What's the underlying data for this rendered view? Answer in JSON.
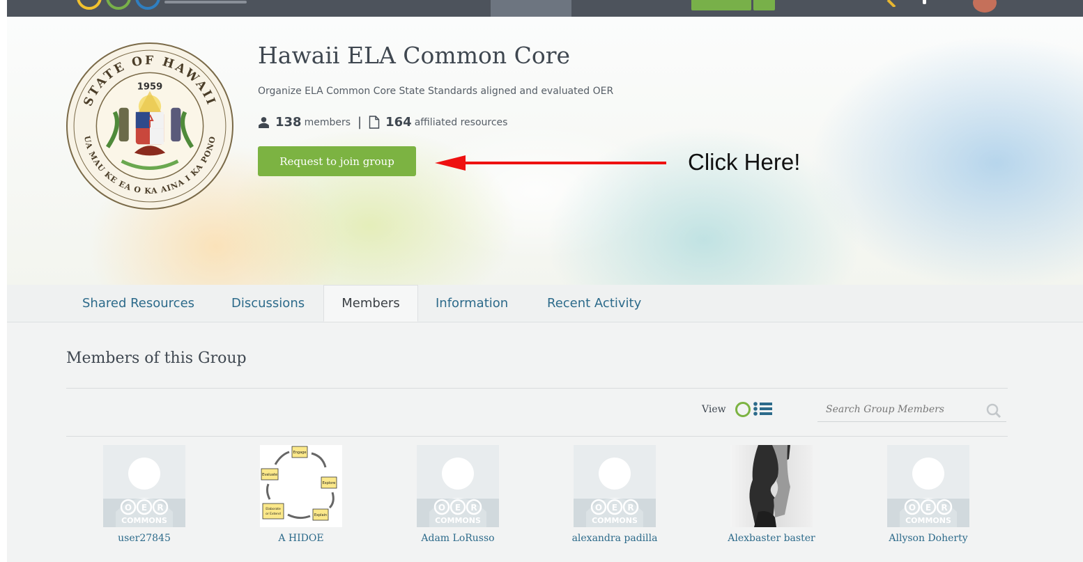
{
  "header": {
    "logo_colors": [
      "#f2c12e",
      "#78b049",
      "#2f7fc1"
    ]
  },
  "group": {
    "title": "Hawaii ELA Common Core",
    "description": "Organize ELA Common Core State Standards aligned and evaluated OER",
    "members_count": "138",
    "members_label": "members",
    "separator": "|",
    "resources_count": "164",
    "resources_label": "affiliated resources",
    "join_label": "Request to join group",
    "seal": {
      "year": "1959",
      "top_text": "STATE OF HAWAII",
      "bottom_text": "UA MAU KE EA O KA AINA I KA PONO"
    }
  },
  "annotation": {
    "text": "Click Here!",
    "arrow_color": "#ee1111"
  },
  "tabs": [
    {
      "label": "Shared Resources"
    },
    {
      "label": "Discussions"
    },
    {
      "label": "Members",
      "active": true
    },
    {
      "label": "Information"
    },
    {
      "label": "Recent Activity"
    }
  ],
  "members_section": {
    "title": "Members of this Group",
    "view_label": "View",
    "search_placeholder": "Search Group Members",
    "placeholder_logo_text": "OER",
    "placeholder_logo_subtext": "COMMONS",
    "cycle_labels": [
      "Engage",
      "Explore",
      "Explain",
      "Elaborate or Extend",
      "Evaluate"
    ],
    "members": [
      {
        "name": "user27845",
        "avatar": "placeholder"
      },
      {
        "name": "A HIDOE",
        "avatar": "5e-cycle"
      },
      {
        "name": "Adam LoRusso",
        "avatar": "placeholder"
      },
      {
        "name": "alexandra padilla",
        "avatar": "placeholder"
      },
      {
        "name": "Alexbaster baster",
        "avatar": "photo"
      },
      {
        "name": "Allyson Doherty",
        "avatar": "placeholder"
      }
    ]
  },
  "colors": {
    "accent_green": "#7cb342",
    "link_blue": "#2c6a8a",
    "topbar": "#4d535c"
  }
}
